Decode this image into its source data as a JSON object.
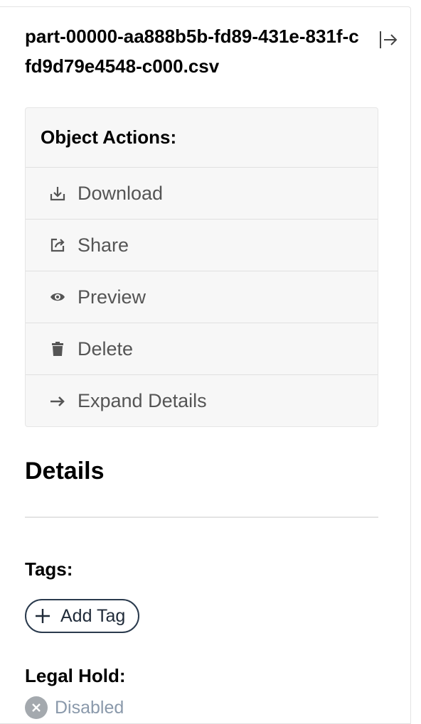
{
  "object": {
    "file_name": "part-00000-aa888b5b-fd89-431e-831f-cfd9d79e4548-c000.csv"
  },
  "actions": {
    "title": "Object Actions:",
    "items": [
      {
        "label": "Download",
        "icon": "download-icon"
      },
      {
        "label": "Share",
        "icon": "share-icon"
      },
      {
        "label": "Preview",
        "icon": "eye-icon"
      },
      {
        "label": "Delete",
        "icon": "trash-icon"
      },
      {
        "label": "Expand Details",
        "icon": "arrow-right-icon"
      }
    ]
  },
  "details": {
    "title": "Details",
    "tags_label": "Tags:",
    "add_tag_label": "Add Tag",
    "legal_hold_label": "Legal Hold:",
    "legal_hold_status": "Disabled"
  },
  "colors": {
    "action_text": "#555555",
    "panel_bg": "#f7f7f7",
    "tag_border": "#2a3a4d",
    "disabled_text": "#8a99ab"
  }
}
